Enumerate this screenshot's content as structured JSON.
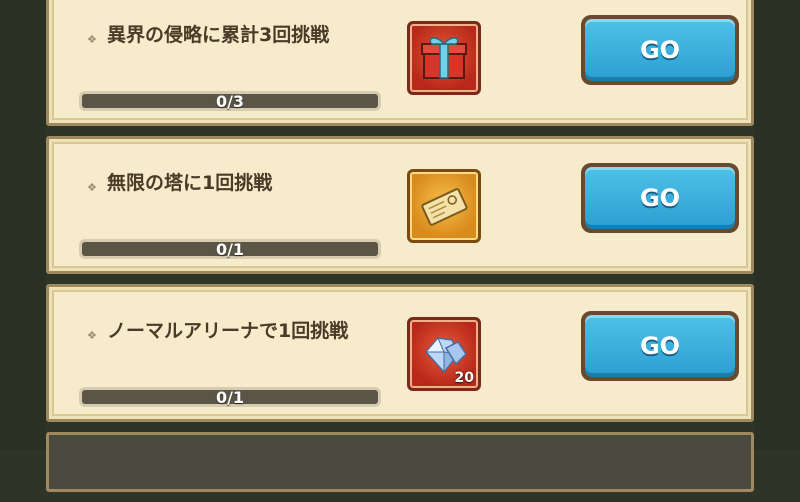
{
  "missions": [
    {
      "title": "異界の侵略に累計3回挑戦",
      "progress_text": "0/3",
      "progress": 0,
      "reward_icon": "gift-box-icon",
      "reward_qty": "",
      "button_label": "GO"
    },
    {
      "title": "無限の塔に1回挑戦",
      "progress_text": "0/1",
      "progress": 0,
      "reward_icon": "ticket-icon",
      "reward_qty": "",
      "button_label": "GO"
    },
    {
      "title": "ノーマルアリーナで1回挑戦",
      "progress_text": "0/1",
      "progress": 0,
      "reward_icon": "diamond-icon",
      "reward_qty": "20",
      "button_label": "GO"
    }
  ],
  "colors": {
    "button": "#2a9fd0",
    "card_bg": "#f6eccb",
    "progress_track": "#5a5546"
  }
}
